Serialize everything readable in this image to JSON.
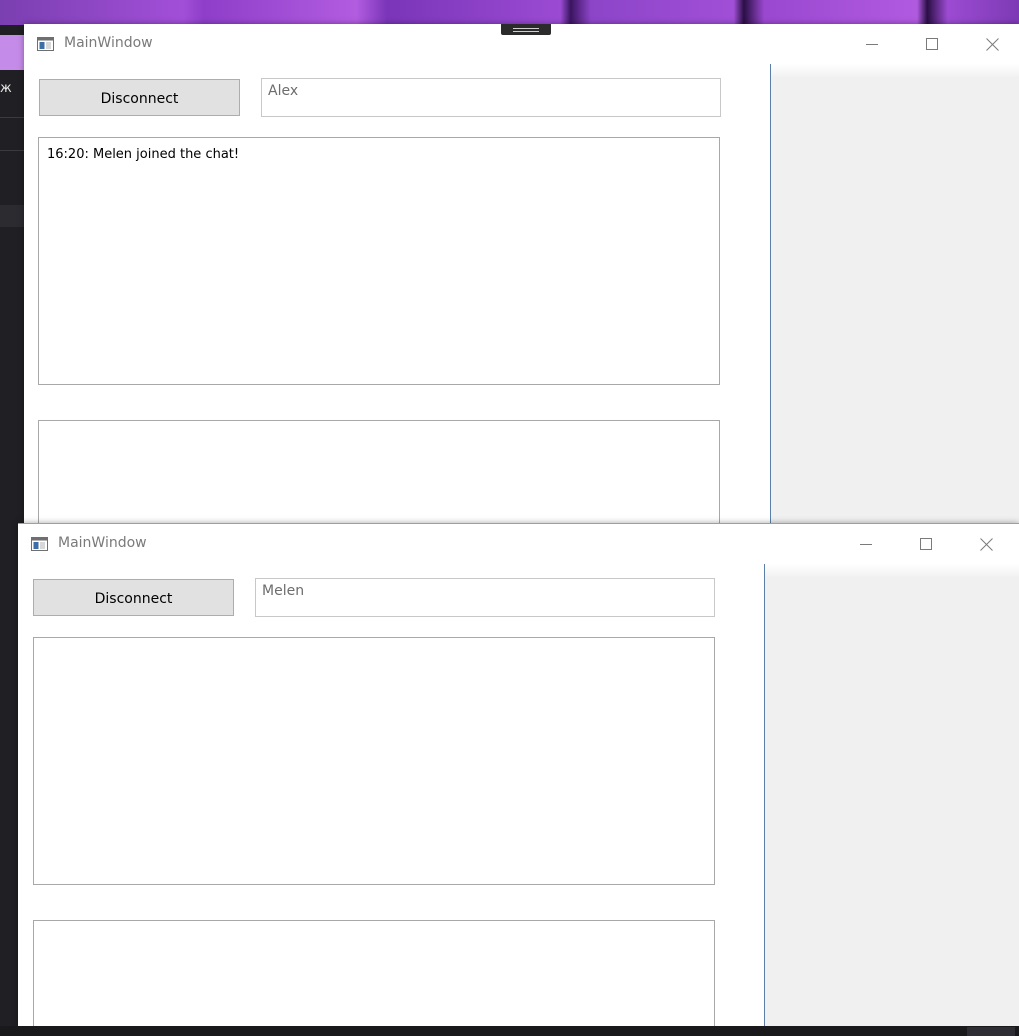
{
  "background": {
    "left_text": "ж"
  },
  "windows": [
    {
      "title": "MainWindow",
      "disconnect_label": "Disconnect",
      "name_value": "Alex",
      "messages": [
        "16:20: Melen joined the chat!"
      ],
      "input_text": ""
    },
    {
      "title": "MainWindow",
      "disconnect_label": "Disconnect",
      "name_value": "Melen",
      "messages": [],
      "input_text": ""
    }
  ],
  "colors": {
    "panel_border": "#5b7fa8",
    "button_bg": "#e1e1e1",
    "panel_bg": "#f0f0f0"
  },
  "icons": [
    "app-window-icon",
    "minimize-icon",
    "maximize-icon",
    "close-icon"
  ]
}
